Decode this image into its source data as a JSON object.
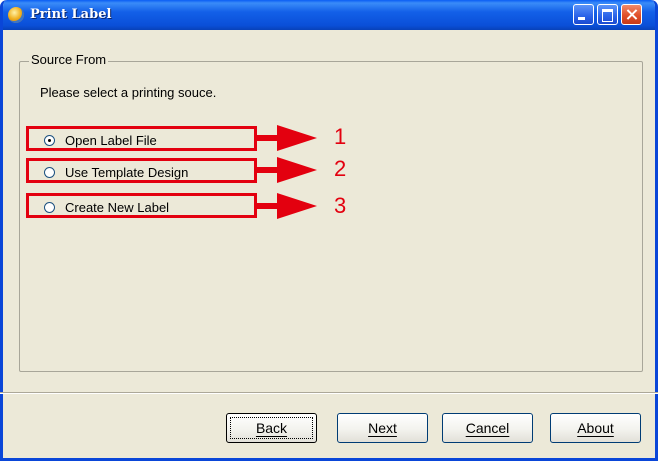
{
  "window": {
    "title": "Print Label",
    "icon": "app-globe-icon"
  },
  "titlebar_buttons": {
    "minimize": "minimize-icon",
    "maximize": "maximize-icon",
    "close": "close-icon"
  },
  "source_group": {
    "label": "Source From",
    "instruction": "Please select a printing souce.",
    "options": [
      {
        "label": "Open Label File",
        "checked": true
      },
      {
        "label": "Use Template Design",
        "checked": false
      },
      {
        "label": "Create New Label",
        "checked": false
      }
    ]
  },
  "annotations": {
    "color": "#e3000f",
    "numbers": [
      "1",
      "2",
      "3"
    ]
  },
  "buttons": {
    "back": "Back",
    "next": "Next",
    "cancel": "Cancel",
    "about": "About"
  }
}
